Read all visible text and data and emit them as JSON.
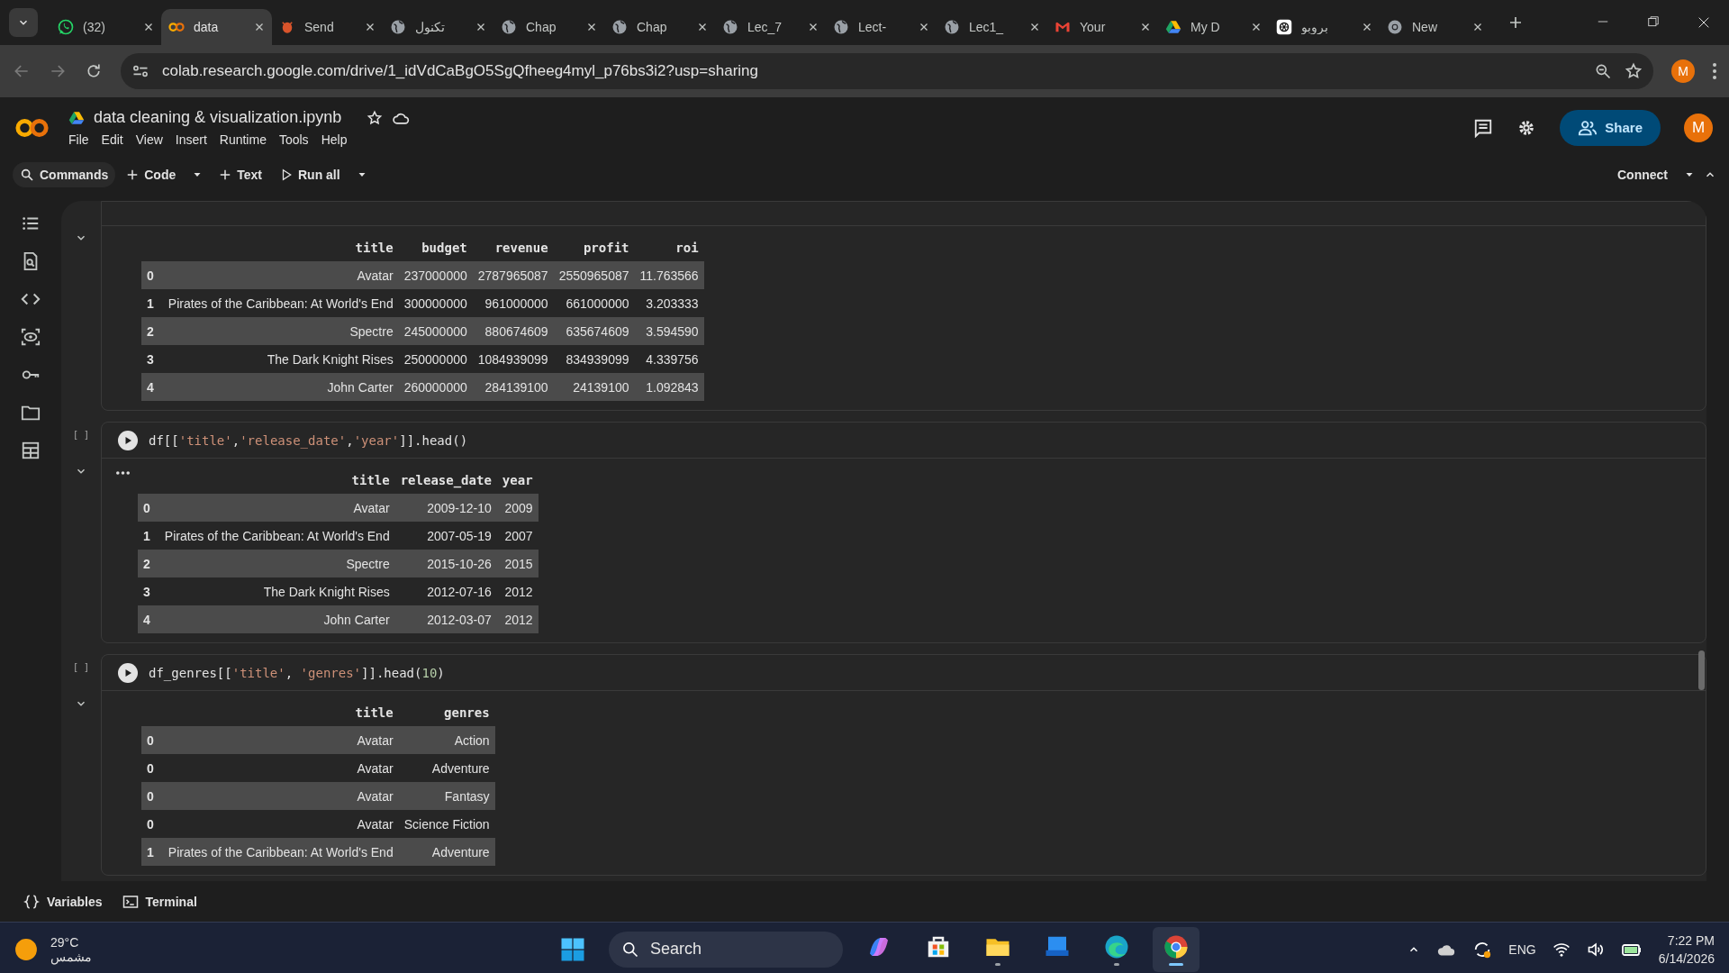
{
  "browser": {
    "tabs": [
      {
        "kind": "whatsapp",
        "title": "(32)",
        "selected": false
      },
      {
        "kind": "colab",
        "title": "data",
        "selected": true
      },
      {
        "kind": "bug",
        "title": "Send",
        "selected": false
      },
      {
        "kind": "globe",
        "title": "تكنول",
        "selected": false
      },
      {
        "kind": "globe",
        "title": "Chap",
        "selected": false
      },
      {
        "kind": "globe",
        "title": "Chap",
        "selected": false
      },
      {
        "kind": "globe",
        "title": "Lec_7",
        "selected": false
      },
      {
        "kind": "globe",
        "title": "Lect-",
        "selected": false
      },
      {
        "kind": "globe",
        "title": "Lec1_",
        "selected": false
      },
      {
        "kind": "gmail",
        "title": "Your",
        "selected": false
      },
      {
        "kind": "drive",
        "title": "My D",
        "selected": false
      },
      {
        "kind": "openai",
        "title": "بروبو",
        "selected": false
      },
      {
        "kind": "chrome",
        "title": "New",
        "selected": false
      }
    ],
    "url": "colab.research.google.com/drive/1_idVdCaBgO5SgQfheeg4myl_p76bs3i2?usp=sharing",
    "profile": "M"
  },
  "notebook": {
    "title": "data cleaning & visualization.ipynb",
    "menu": [
      "File",
      "Edit",
      "View",
      "Insert",
      "Runtime",
      "Tools",
      "Help"
    ],
    "toolbar": [
      {
        "kind": "search",
        "label": "Commands"
      },
      {
        "kind": "plus",
        "label": "Code"
      },
      {
        "kind": "caret"
      },
      {
        "kind": "plus",
        "label": "Text"
      },
      {
        "kind": "play",
        "label": "Run all"
      },
      {
        "kind": "caret"
      }
    ],
    "share": "Share",
    "avatar": "M",
    "connect": "Connect"
  },
  "cells": [
    {
      "output_menu": false,
      "table": {
        "columns": [
          "title",
          "budget",
          "revenue",
          "profit",
          "roi"
        ],
        "rows": [
          {
            "index": "0",
            "cells": [
              "Avatar",
              "237000000",
              "2787965087",
              "2550965087",
              "11.763566"
            ]
          },
          {
            "index": "1",
            "cells": [
              "Pirates of the Caribbean: At World's End",
              "300000000",
              "961000000",
              "661000000",
              "3.203333"
            ]
          },
          {
            "index": "2",
            "cells": [
              "Spectre",
              "245000000",
              "880674609",
              "635674609",
              "3.594590"
            ]
          },
          {
            "index": "3",
            "cells": [
              "The Dark Knight Rises",
              "250000000",
              "1084939099",
              "834939099",
              "4.339756"
            ]
          },
          {
            "index": "4",
            "cells": [
              "John Carter",
              "260000000",
              "284139100",
              "24139100",
              "1.092843"
            ]
          }
        ]
      }
    },
    {
      "bracket": "[ ]",
      "code": "df[['title','release_date','year']].head()",
      "output_menu": true,
      "table": {
        "columns": [
          "title",
          "release_date",
          "year"
        ],
        "rows": [
          {
            "index": "0",
            "cells": [
              "Avatar",
              "2009-12-10",
              "2009"
            ]
          },
          {
            "index": "1",
            "cells": [
              "Pirates of the Caribbean: At World's End",
              "2007-05-19",
              "2007"
            ]
          },
          {
            "index": "2",
            "cells": [
              "Spectre",
              "2015-10-26",
              "2015"
            ]
          },
          {
            "index": "3",
            "cells": [
              "The Dark Knight Rises",
              "2012-07-16",
              "2012"
            ]
          },
          {
            "index": "4",
            "cells": [
              "John Carter",
              "2012-03-07",
              "2012"
            ]
          }
        ]
      }
    },
    {
      "bracket": "[ ]",
      "code": "df_genres[['title', 'genres']].head(10)",
      "output_menu": false,
      "table": {
        "columns": [
          "title",
          "genres"
        ],
        "rows": [
          {
            "index": "0",
            "cells": [
              "Avatar",
              "Action"
            ]
          },
          {
            "index": "0",
            "cells": [
              "Avatar",
              "Adventure"
            ]
          },
          {
            "index": "0",
            "cells": [
              "Avatar",
              "Fantasy"
            ]
          },
          {
            "index": "0",
            "cells": [
              "Avatar",
              "Science Fiction"
            ]
          },
          {
            "index": "1",
            "cells": [
              "Pirates of the Caribbean: At World's End",
              "Adventure"
            ]
          }
        ]
      }
    }
  ],
  "bottom_bar": [
    {
      "kind": "braces",
      "label": "Variables"
    },
    {
      "kind": "terminal",
      "label": "Terminal"
    }
  ],
  "taskbar": {
    "weather": {
      "temperature": "29°C",
      "condition": "مشمس"
    },
    "search": {
      "placeholder": "Search"
    },
    "apps": [
      {
        "kind": "copilot",
        "running": false,
        "selected": false
      },
      {
        "kind": "store",
        "running": false,
        "selected": false
      },
      {
        "kind": "explorer",
        "running": true,
        "selected": false
      },
      {
        "kind": "app",
        "running": false,
        "selected": false
      },
      {
        "kind": "edge",
        "running": true,
        "selected": false
      },
      {
        "kind": "chrome",
        "running": true,
        "selected": true
      }
    ],
    "language": "ENG",
    "time": "7:22 PM",
    "date": "6/14/2026"
  }
}
